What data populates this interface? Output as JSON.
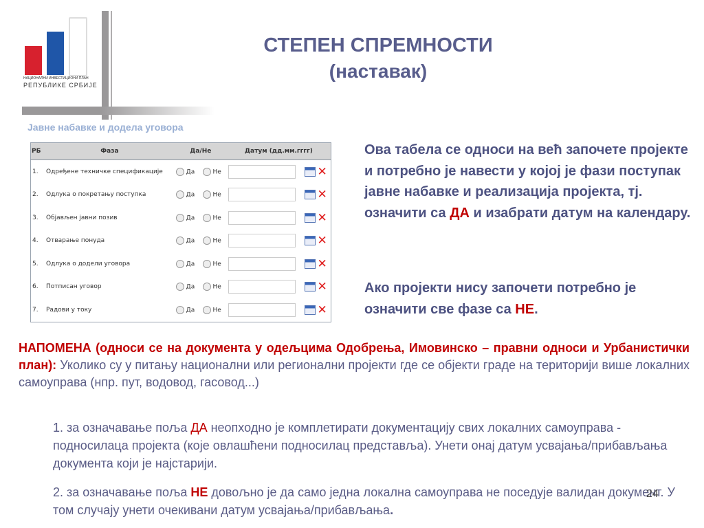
{
  "logo": {
    "line1": "НАЦИОНАЛНИ ИНВЕСТИЦИОНИ ПЛАН",
    "line2": "РЕПУБЛИКЕ СРБИЈЕ"
  },
  "title": {
    "line1": "СТЕПЕН СПРЕМНОСТИ",
    "line2": "(наставак)"
  },
  "section": "Јавне набавке и додела уговора",
  "table": {
    "headers": [
      "РБ",
      "Фаза",
      "Да/Не",
      "Датум (дд.мм.гггг)"
    ],
    "yes": "Да",
    "no": "Не",
    "rows": [
      {
        "n": "1.",
        "phase": "Одређене техничке спецификације"
      },
      {
        "n": "2.",
        "phase": "Одлука о покретању поступка"
      },
      {
        "n": "3.",
        "phase": "Објављен јавни позив"
      },
      {
        "n": "4.",
        "phase": "Отварање понуда"
      },
      {
        "n": "5.",
        "phase": "Одлука о додели уговора"
      },
      {
        "n": "6.",
        "phase": "Потписан уговор"
      },
      {
        "n": "7.",
        "phase": "Радови у току"
      }
    ]
  },
  "right": {
    "p1a": "Ова табела се односи на већ започете пројекте и потребно је навести у којој је фази поступак јавне набавке и реализација пројекта, тј. означити са ",
    "p1b": "ДА",
    "p1c": " и изабрати датум на календару.",
    "p2a": "Ако пројекти нису започети потребно је означити све фазе са ",
    "p2b": "НЕ",
    "p2c": "."
  },
  "note": {
    "head": "НАПОМЕНА (односи се на документа у одељцима Одобрења, Имовинско – правни односи и Урбанистички план):",
    "body": "  Уколико су у питању национални или регионални пројекти где се објекти граде на територији више локалних самоуправа (нпр. пут, водовод, гасовод...)"
  },
  "item1": {
    "a": "1. за означавање поља ",
    "b": "ДА",
    "c": " неопходно је комплетирати документацију свих локалних самоуправа - подносилаца пројекта (које овлашћени подносилац представља). Унети онај датум усвајања/прибављања документа који је најстарији."
  },
  "item2": {
    "a": "2. за означавање поља ",
    "b": "НЕ",
    "c": " довољно је да само једна локална самоуправа не поседује валидан документ. У том случају унети очекивани датум усвајања/прибављања",
    "d": "."
  },
  "page": "24"
}
